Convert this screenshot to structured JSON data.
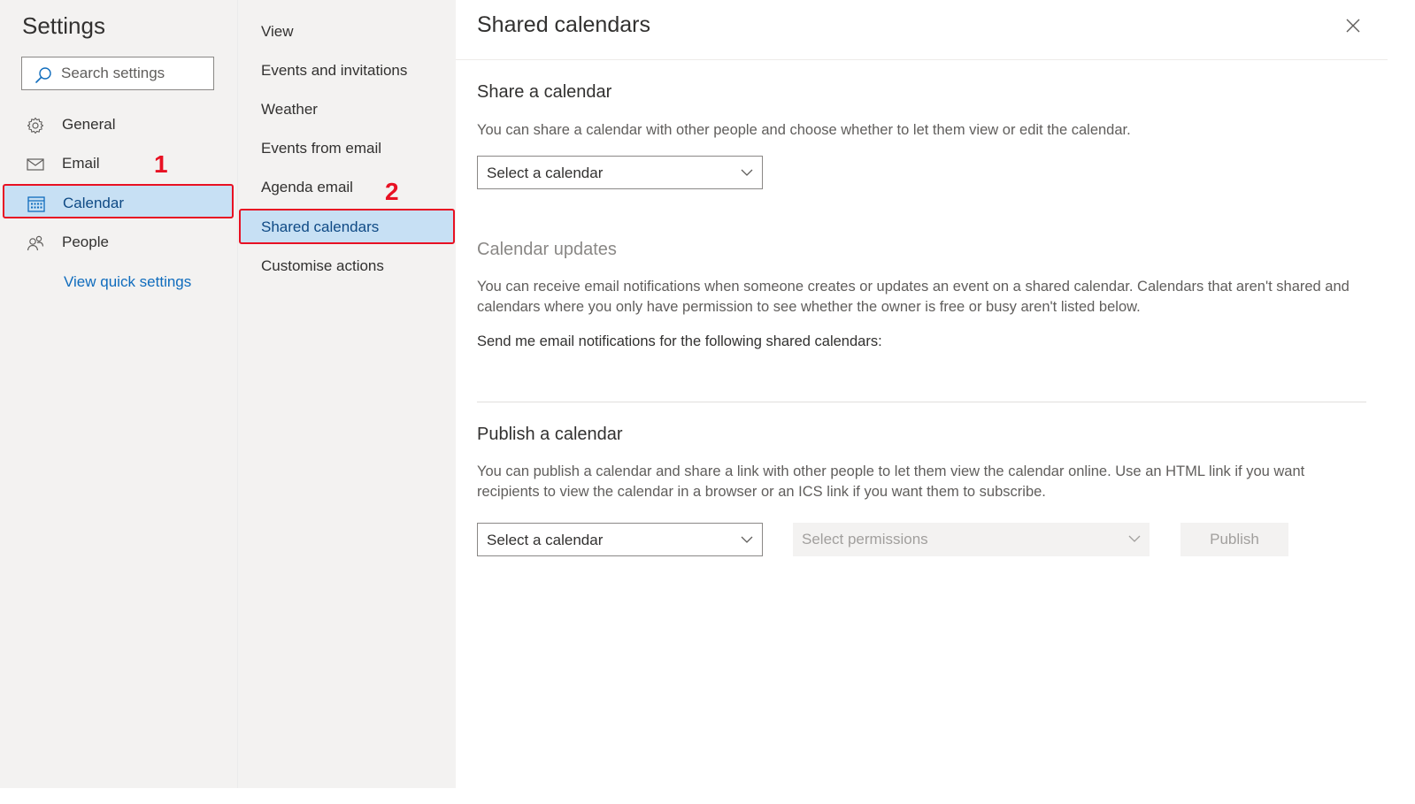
{
  "sidebar": {
    "title": "Settings",
    "search_placeholder": "Search settings",
    "items": [
      {
        "label": "General",
        "icon": "gear-icon"
      },
      {
        "label": "Email",
        "icon": "mail-icon"
      },
      {
        "label": "Calendar",
        "icon": "calendar-icon",
        "selected": true
      },
      {
        "label": "People",
        "icon": "people-icon"
      }
    ],
    "quick_settings_link": "View quick settings"
  },
  "submenu": {
    "items": [
      {
        "label": "View"
      },
      {
        "label": "Events and invitations"
      },
      {
        "label": "Weather"
      },
      {
        "label": "Events from email"
      },
      {
        "label": "Agenda email"
      },
      {
        "label": "Shared calendars",
        "selected": true
      },
      {
        "label": "Customise actions"
      }
    ]
  },
  "annotations": {
    "marker1": "1",
    "marker2": "2",
    "color": "#e81123"
  },
  "main": {
    "title": "Shared calendars",
    "share": {
      "heading": "Share a calendar",
      "description": "You can share a calendar with other people and choose whether to let them view or edit the calendar.",
      "dropdown": "Select a calendar"
    },
    "updates": {
      "heading": "Calendar updates",
      "description": "You can receive email notifications when someone creates or updates an event on a shared calendar. Calendars that aren't shared and calendars where you only have permission to see whether the owner is free or busy aren't listed below.",
      "prompt": "Send me email notifications for the following shared calendars:"
    },
    "publish": {
      "heading": "Publish a calendar",
      "description": "You can publish a calendar and share a link with other people to let them view the calendar online. Use an HTML link if you want recipients to view the calendar in a browser or an ICS link if you want them to subscribe.",
      "calendar_dropdown": "Select a calendar",
      "permissions_dropdown": "Select permissions",
      "publish_button": "Publish"
    }
  },
  "colors": {
    "accent": "#0f6cbd",
    "selected_bg": "#c7e0f4",
    "highlight_border": "#e81123"
  }
}
